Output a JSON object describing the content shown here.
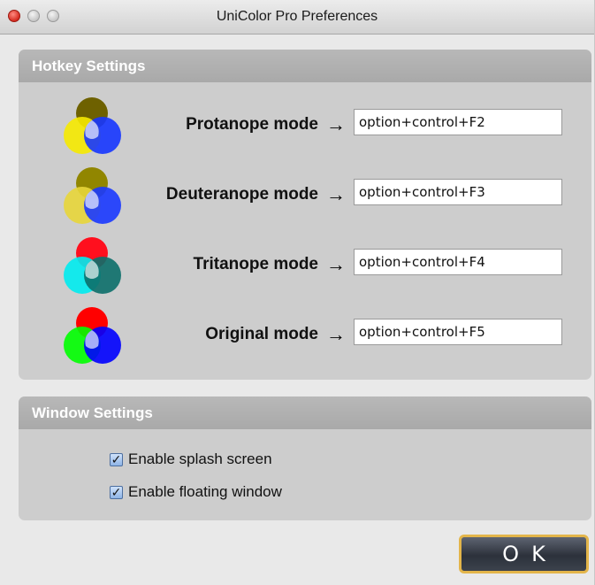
{
  "window": {
    "title": "UniColor Pro Preferences"
  },
  "hotkey_settings": {
    "header": "Hotkey Settings",
    "arrow": "→",
    "rows": [
      {
        "label": "Protanope mode",
        "value": "option+control+F2",
        "icon": "protanope-venn-icon",
        "colors": {
          "top": "#6e6100",
          "left": "#f6ea00",
          "right": "#1636ff",
          "overlap": "#ffffff"
        }
      },
      {
        "label": "Deuteranope mode",
        "value": "option+control+F3",
        "icon": "deuteranope-venn-icon",
        "colors": {
          "top": "#918600",
          "left": "#e8d63a",
          "right": "#1a39ff",
          "overlap": "#ffffff"
        }
      },
      {
        "label": "Tritanope mode",
        "value": "option+control+F4",
        "icon": "tritanope-venn-icon",
        "colors": {
          "top": "#ff0f1e",
          "left": "#00ecef",
          "right": "#0c6f6a",
          "overlap": "#ffffff"
        }
      },
      {
        "label": "Original mode",
        "value": "option+control+F5",
        "icon": "original-venn-icon",
        "colors": {
          "top": "#ff0000",
          "left": "#00ff00",
          "right": "#0000ff",
          "overlap": "#ffffff"
        }
      }
    ]
  },
  "window_settings": {
    "header": "Window Settings",
    "options": [
      {
        "label": "Enable splash screen",
        "checked": true
      },
      {
        "label": "Enable floating window",
        "checked": true
      }
    ]
  },
  "ok_button": {
    "label": "OK"
  }
}
